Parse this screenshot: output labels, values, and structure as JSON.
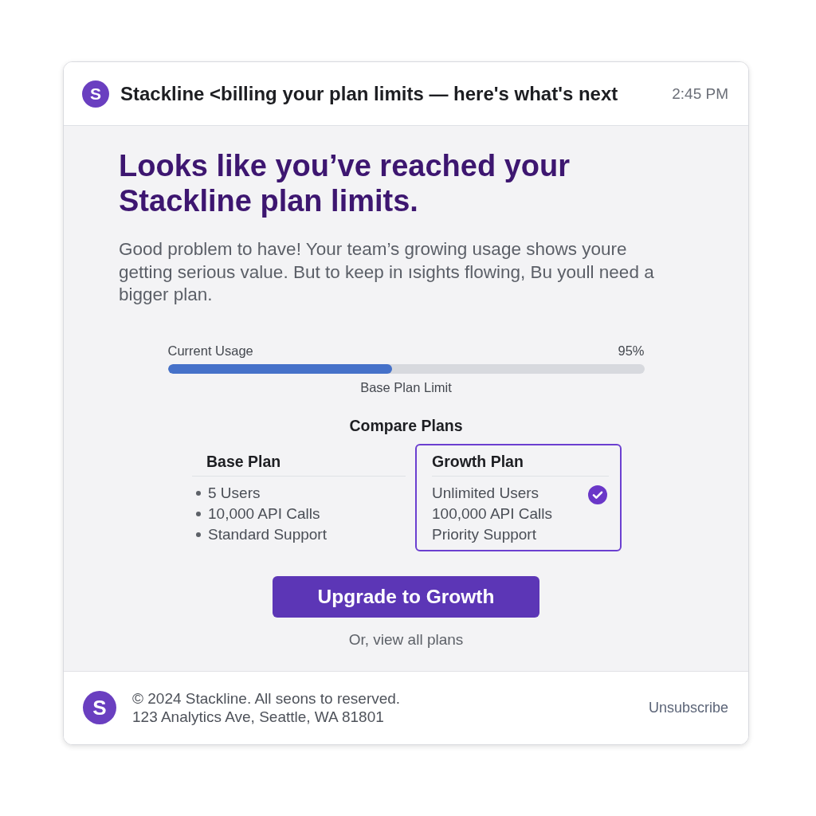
{
  "header": {
    "avatar_initial": "S",
    "subject": "Stackline <billing your plan limits — here's what's next",
    "time": "2:45 PM"
  },
  "body": {
    "heading": "Looks like you’ve reached your Stackline plan limits.",
    "paragraph": "Good problem to have! Your team’s growing usage shows youre getting serious value. But to keep in ısights flowing, Bu youll need a bigger plan.",
    "usage": {
      "label": "Current Usage",
      "reading": "95%",
      "level": 0.47,
      "caption": "Base Plan Limit"
    },
    "compare": {
      "title": "Compare Plans",
      "plans": [
        {
          "name": "Base Plan",
          "selected": false,
          "features": [
            "5 Users",
            "10,000 API Calls",
            "Standard Support"
          ]
        },
        {
          "name": "Growth Plan",
          "selected": true,
          "features": [
            "Unlimited Users",
            "100,000 API Calls",
            "Priority Support"
          ]
        }
      ]
    },
    "cta": {
      "button": "Upgrade to Growth",
      "link": "Or, view all plans"
    }
  },
  "footer": {
    "logo_initial": "S",
    "copyright": "© 2024 Stackline. All seons to reserved.",
    "address": "123 Analytics Ave, Seattle, WA 81801",
    "unsubscribe": "Unsubscribe"
  }
}
